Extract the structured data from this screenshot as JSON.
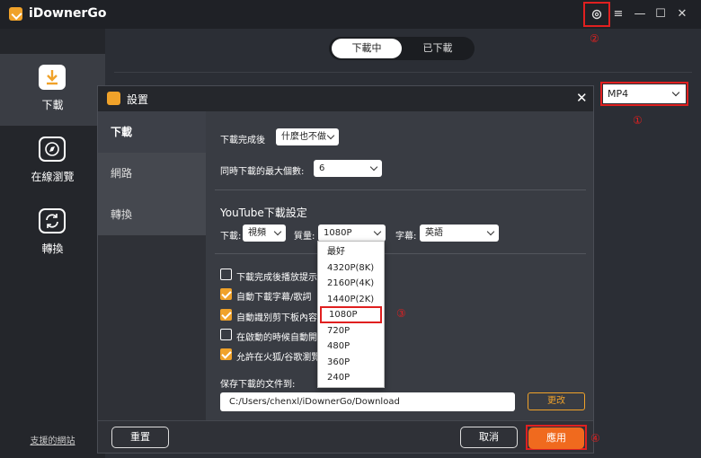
{
  "app": {
    "title": "iDownerGo"
  },
  "sidebar": {
    "items": [
      {
        "label": "下載",
        "icon": "download-icon",
        "active": true
      },
      {
        "label": "在線瀏覽",
        "icon": "compass-icon",
        "active": false
      },
      {
        "label": "轉換",
        "icon": "convert-icon",
        "active": false
      }
    ],
    "support_link": "支援的網站"
  },
  "tabs": {
    "downloading": "下載中",
    "downloaded": "已下載"
  },
  "format_select": {
    "value": "MP4"
  },
  "annotations": {
    "a1": "①",
    "a2": "②",
    "a3": "③",
    "a4": "④"
  },
  "dialog": {
    "title": "設置",
    "tabs": [
      "下載",
      "網路",
      "轉換"
    ],
    "after_download_label": "下載完成後",
    "after_download_value": "什麼也不做",
    "max_downloads_label": "同時下載的最大個數:",
    "max_downloads_value": "6",
    "youtube_heading": "YouTube下載設定",
    "download_label": "下載:",
    "download_value": "視頻",
    "quality_label": "質量:",
    "quality_value": "1080P",
    "subtitle_label": "字幕:",
    "subtitle_value": "英語",
    "checkboxes": [
      {
        "label": "下載完成後播放提示音",
        "checked": false
      },
      {
        "label": "自動下載字幕/歌詞",
        "checked": true
      },
      {
        "label": "自動識別剪下板內容",
        "checked": true
      },
      {
        "label": "在啟動的時候自動開始",
        "checked": false
      },
      {
        "label": "允許在火狐/谷歌瀏覽器",
        "checked": true
      }
    ],
    "save_path_label": "保存下載的文件到:",
    "save_path_value": "C:/Users/chenxl/iDownerGo/Download",
    "change_button": "更改",
    "reset_button": "重置",
    "cancel_button": "取消",
    "apply_button": "應用"
  },
  "quality_dropdown": {
    "options": [
      "最好",
      "4320P(8K)",
      "2160P(4K)",
      "1440P(2K)",
      "1080P",
      "720P",
      "480P",
      "360P",
      "240P"
    ],
    "selected_index": 4
  },
  "colors": {
    "accent": "#f0a22a",
    "apply": "#f06a1e",
    "highlight": "#e02020"
  }
}
